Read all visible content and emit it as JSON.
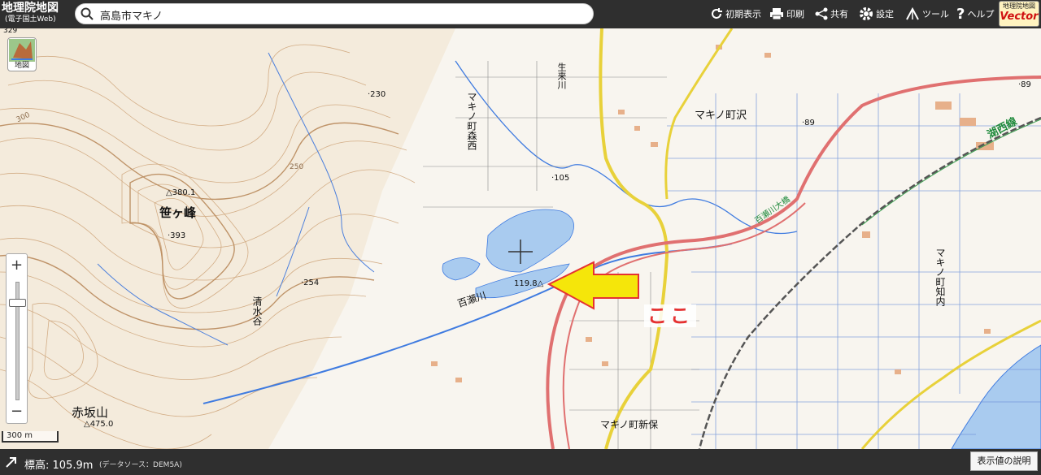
{
  "app": {
    "logo_title": "地理院地図",
    "logo_subtitle": "(電子国土Web)"
  },
  "search": {
    "value": "高島市マキノ"
  },
  "toolbar": {
    "reset_label": "初期表示",
    "print_label": "印刷",
    "share_label": "共有",
    "settings_label": "設定",
    "tools_label": "ツール",
    "help_label": "ヘルプ",
    "vector_badge_top": "地理院地図",
    "vector_badge_label": "Vector"
  },
  "layer_button": {
    "label": "地図",
    "icon": "map-thumbnail-icon"
  },
  "zoom": {
    "plus": "+",
    "minus": "−"
  },
  "scale_bar": {
    "label": "300 m"
  },
  "map_labels": {
    "sasagamine": "笹ヶ峰",
    "akasakayama": "赤坂山",
    "shimizudani": "清水谷",
    "momosegawa": "百瀬川",
    "ikikugawa": "生来川",
    "makino_morinishi": "マキノ町森西",
    "makino_sawa": "マキノ町沢",
    "makino_chinai": "マキノ町知内",
    "makino_shinpo": "マキノ町新保",
    "kosei_line": "湖西線",
    "momosegawa_bridge": "百瀬川大橋",
    "pt_380": "△380.1",
    "pt_393": "·393",
    "pt_254": "·254",
    "pt_230": "·230",
    "pt_105": "·105",
    "pt_89a": "·89",
    "pt_89b": "·89",
    "pt_1198": "119.8△",
    "pt_475": "△475.0",
    "pt_329": "329",
    "pt_300": "300",
    "pt_250": "250"
  },
  "annotation": {
    "text": "ここ"
  },
  "footer": {
    "elevation": "標高: 105.9m",
    "elevation_source": "(データソース：DEM5A)",
    "explain_button": "表示値の説明"
  },
  "colors": {
    "toolbar_bg": "#2f2f2f",
    "water": "#a9cbef",
    "river": "#3f7be0",
    "road_red": "#e07070",
    "road_yellow": "#e8d13a",
    "contour": "#c9a27a",
    "arrow_fill": "#f5e60a",
    "arrow_stroke": "#e53232",
    "annotation_text": "#e53232"
  }
}
